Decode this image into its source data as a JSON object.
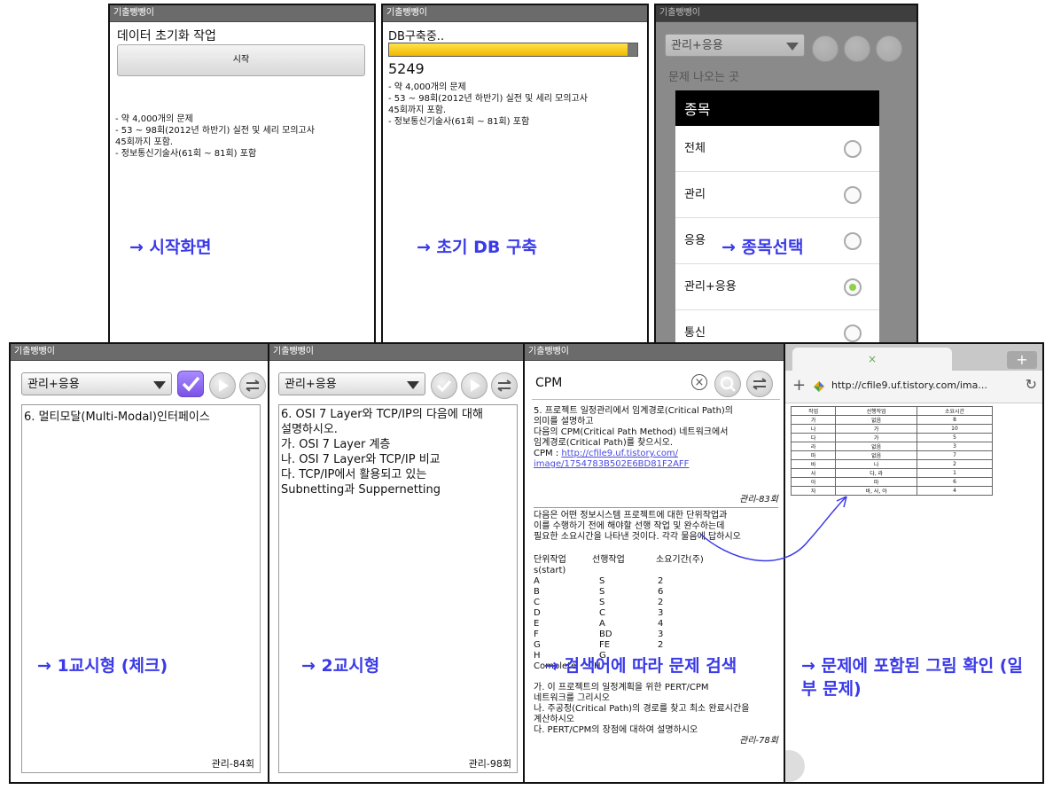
{
  "app_title": "기출뺑뺑이",
  "screen1": {
    "heading": "데이터 초기화 작업",
    "start_button": "시작",
    "desc": [
      "- 약 4,000개의 문제",
      "- 53 ~ 98회(2012년 하반기) 실전 및 세리 모의고사",
      "45회까지 포함.",
      "- 정보통신기술사(61회 ~ 81회) 포함"
    ],
    "annotation": "→ 시작화면"
  },
  "screen2": {
    "heading": "DB구축중..",
    "progress": 0.96,
    "count": "5249",
    "desc": [
      "- 약 4,000개의 문제",
      "- 53 ~ 98회(2012년 하반기) 실전 및 세리 모의고사",
      "45회까지 포함.",
      "- 정보통신기술사(61회 ~ 81회) 포함"
    ],
    "annotation": "→ 초기 DB 구축"
  },
  "screen3": {
    "dropdown": "관리+응용",
    "section_label": "문제 나오는 곳",
    "dialog_title": "종목",
    "options": [
      "전체",
      "관리",
      "응용",
      "관리+응용",
      "통신"
    ],
    "selected_index": 3,
    "annotation": "→ 종목선택"
  },
  "screen4": {
    "dropdown": "관리+응용",
    "question": "6. 멀티모달(Multi-Modal)인터페이스",
    "source": "관리-84회",
    "annotation": "→ 1교시형 (체크)"
  },
  "screen5": {
    "dropdown": "관리+응용",
    "question": [
      "6. OSI 7 Layer와 TCP/IP의 다음에 대해",
      "설명하시오.",
      "가. OSI 7 Layer 계층",
      "나. OSI  7 Layer와 TCP/IP 비교",
      "다. TCP/IP에서 활용되고 있는",
      "Subnetting과 Suppernetting"
    ],
    "source": "관리-98회",
    "annotation": "→ 2교시형"
  },
  "screen6": {
    "search_value": "CPM",
    "q1": [
      "5. 프로젝트 일정관리에서 임계경로(Critical Path)의",
      "의미를 설명하고",
      "다음의 CPM(Critical Path Method) 네트워크에서",
      "임계경로(Critical Path)를 찾으시오.",
      "CPM : "
    ],
    "q1_link": [
      "http://cfile9.uf.tistory.com/",
      "image/1754783B502E6BD81F2AFF"
    ],
    "q1_source": "관리-83회",
    "q2_intro": [
      "다음은 어떤 정보시스템 프로젝트에 대한 단위작업과",
      "이를 수행하기 전에 해야할 선행 작업 및 완수하는데",
      "필요한 소요시간을 나타낸 것이다. 각각 물음에 답하시오"
    ],
    "q2_headers": [
      "단위작업",
      "선행작업",
      "소요기간(주)"
    ],
    "q2_start": "s(start)",
    "q2_rows": [
      [
        "A",
        "S",
        "2"
      ],
      [
        "B",
        "S",
        "6"
      ],
      [
        "C",
        "S",
        "2"
      ],
      [
        "D",
        "C",
        "3"
      ],
      [
        "E",
        "A",
        "4"
      ],
      [
        "F",
        "BD",
        "3"
      ],
      [
        "G",
        "FE",
        "2"
      ],
      [
        "H",
        "G",
        ""
      ]
    ],
    "q2_complete": [
      "Complete",
      "H"
    ],
    "q2_tail": [
      "가. 이 프로젝트의 일정계획을 위한 PERT/CPM",
      "네트워크를 그리시오",
      "나. 주공정(Critical Path)의 경로를 찾고 최소 완료시간을",
      "계산하시오",
      "다. PERT/CPM의 장점에 대하여 설명하시오"
    ],
    "q2_source": "관리-78회",
    "annotation": "→ 검색어에 따라 문제 검색"
  },
  "screen7": {
    "tab_close": "×",
    "new_tab": "+",
    "url": "http://cfile9.uf.tistory.com/ima...",
    "table_headers": [
      "작업",
      "선행작업",
      "소요시간"
    ],
    "table_rows": [
      [
        "가",
        "없음",
        "8"
      ],
      [
        "나",
        "가",
        "10"
      ],
      [
        "다",
        "가",
        "5"
      ],
      [
        "라",
        "없음",
        "3"
      ],
      [
        "마",
        "없음",
        "7"
      ],
      [
        "바",
        "나",
        "2"
      ],
      [
        "사",
        "다, 라",
        "1"
      ],
      [
        "아",
        "마",
        "6"
      ],
      [
        "자",
        "바, 사, 아",
        "4"
      ]
    ],
    "annotation": "→ 문제에 포함된 그림 확인 (일부 문제)"
  },
  "colors": {
    "annotation": "#3a3ae8",
    "progress": "#f5c400",
    "titlebar": "#6b6b6b",
    "check_active": "#7b52e6",
    "radio_on": "#8dd14a"
  }
}
